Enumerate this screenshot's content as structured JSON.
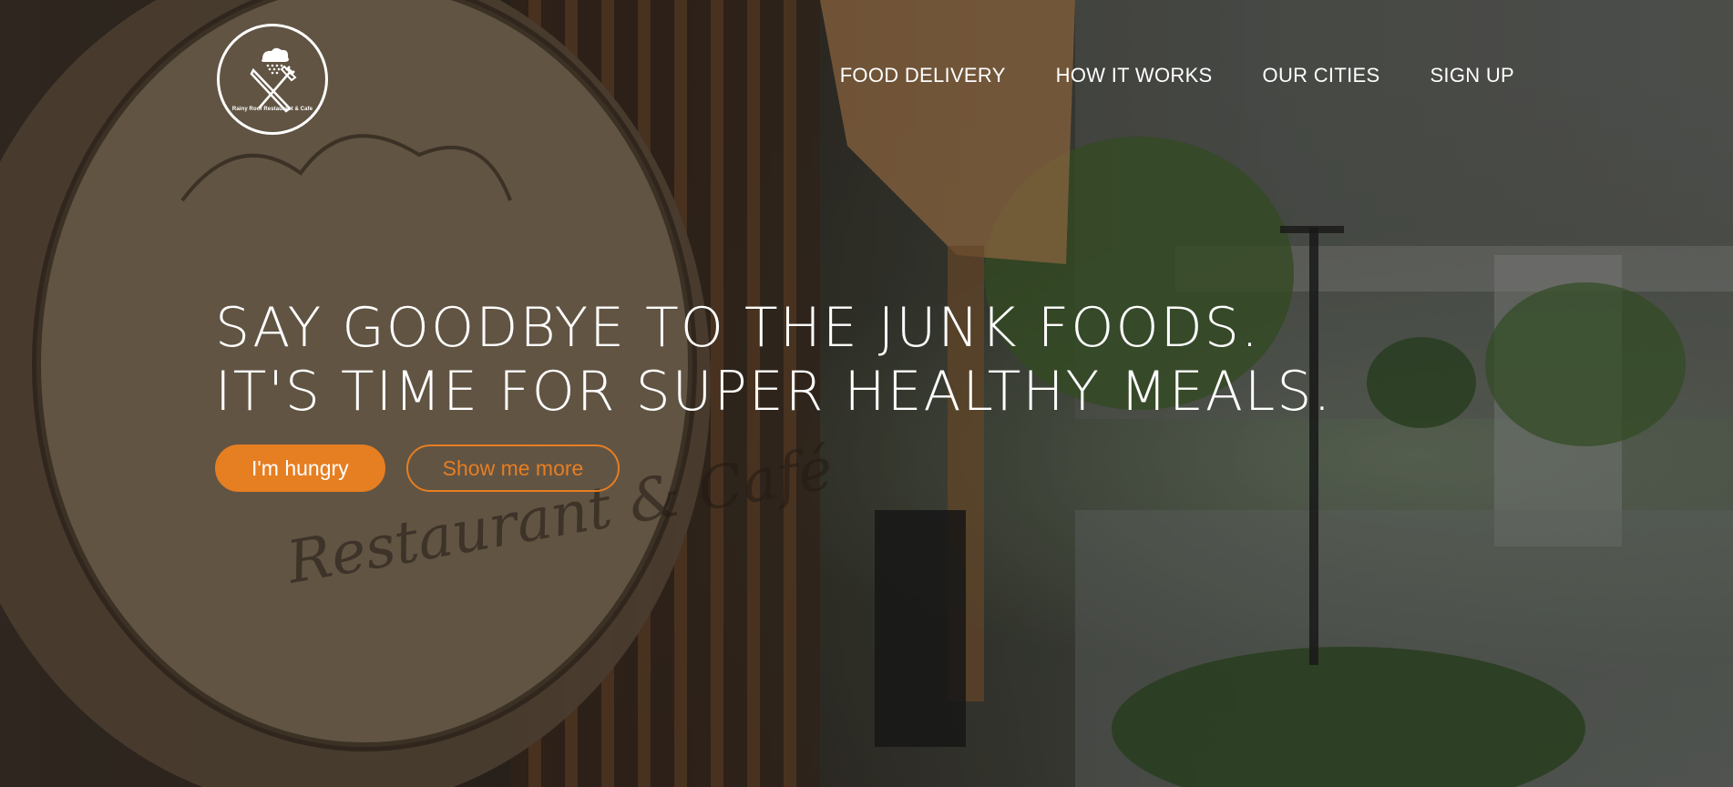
{
  "logo": {
    "caption": "Rainy Roof Restaurant & Cafe",
    "icon": "fork-knife-cloud-icon"
  },
  "nav": {
    "items": [
      "FOOD DELIVERY",
      "HOW IT WORKS",
      "OUR CITIES",
      "SIGN UP"
    ]
  },
  "hero": {
    "headline_line1": "SAY GOODBYE TO THE JUNK FOODS.",
    "headline_line2": "IT'S TIME FOR SUPER HEALTHY MEALS.",
    "primary_button": "I'm hungry",
    "secondary_button": "Show me more"
  },
  "colors": {
    "accent": "#e67e22",
    "text": "#ffffff"
  }
}
